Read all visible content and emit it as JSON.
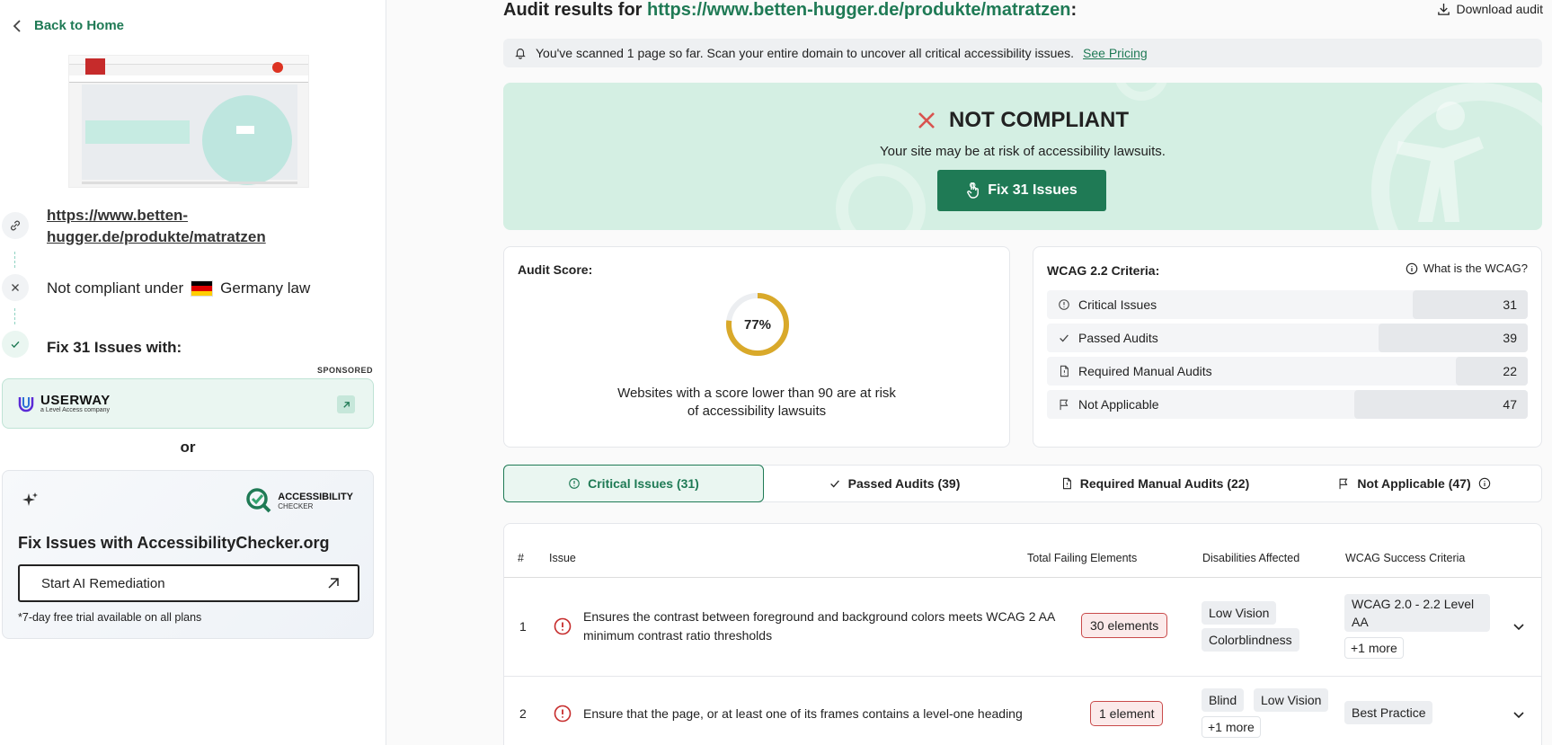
{
  "sidebar": {
    "back_label": "Back to Home",
    "site_url": "https://www.betten-hugger.de/produkte/matratzen",
    "law": {
      "prefix": "Not compliant under",
      "country": "Germany law"
    },
    "fix_with": "Fix 31 Issues with:",
    "sponsored": "SPONSORED",
    "userway": {
      "brand": "USERWAY",
      "sub": "a Level Access company"
    },
    "or": "or",
    "checker": {
      "logo_line1": "ACCESSIBILITY",
      "logo_line2": "CHECKER",
      "title": "Fix Issues with AccessibilityChecker.org",
      "button": "Start AI Remediation",
      "note": "*7-day free trial available on all plans"
    }
  },
  "header": {
    "title_prefix": "Audit results for",
    "title_url": "https://www.betten-hugger.de/produkte/matratzen",
    "title_suffix": ":",
    "download": "Download audit"
  },
  "banner": {
    "text": "You've scanned 1 page so far. Scan your entire domain to uncover all critical accessibility issues.",
    "link": "See Pricing"
  },
  "hero": {
    "status": "NOT COMPLIANT",
    "subtitle": "Your site may be at risk of accessibility lawsuits.",
    "button": "Fix 31 Issues"
  },
  "score": {
    "label": "Audit Score:",
    "value": 77,
    "display": "77%",
    "note": "Websites with a score lower than 90 are at risk of accessibility lawsuits",
    "color": "#d9a92a"
  },
  "wcag": {
    "label": "WCAG 2.2 Criteria:",
    "help": "What is the WCAG?",
    "rows": [
      {
        "label": "Critical Issues",
        "count": "31",
        "icon": "alert-circle-icon",
        "bar": 0.24
      },
      {
        "label": "Passed Audits",
        "count": "39",
        "icon": "check-icon",
        "bar": 0.31
      },
      {
        "label": "Required Manual Audits",
        "count": "22",
        "icon": "document-icon",
        "bar": 0.15
      },
      {
        "label": "Not Applicable",
        "count": "47",
        "icon": "flag-icon",
        "bar": 0.36
      }
    ]
  },
  "tabs": [
    {
      "label": "Critical Issues (31)",
      "active": true
    },
    {
      "label": "Passed Audits (39)",
      "active": false
    },
    {
      "label": "Required Manual Audits (22)",
      "active": false
    },
    {
      "label": "Not Applicable (47)",
      "active": false
    }
  ],
  "table": {
    "columns": [
      "#",
      "Issue",
      "Total Failing Elements",
      "Disabilities Affected",
      "WCAG Success Criteria"
    ],
    "rows": [
      {
        "num": "1",
        "issue": "Ensures the contrast between foreground and background colors meets WCAG 2 AA minimum contrast ratio thresholds",
        "failing": "30 elements",
        "disabilities": [
          "Low Vision",
          "Colorblindness"
        ],
        "criteria": "WCAG 2.0 - 2.2 Level AA",
        "criteria_more": "+1 more"
      },
      {
        "num": "2",
        "issue": "Ensure that the page, or at least one of its frames contains a level-one heading",
        "failing": "1 element",
        "disabilities": [
          "Blind",
          "Low Vision"
        ],
        "disabilities_more": "+1 more",
        "criteria": "Best Practice"
      }
    ]
  },
  "colors": {
    "brand_green": "#1f7a55",
    "error_red": "#c94a4a",
    "hero_bg": "#d4efe3",
    "flag": [
      "#000000",
      "#dd0000",
      "#ffce00"
    ]
  }
}
